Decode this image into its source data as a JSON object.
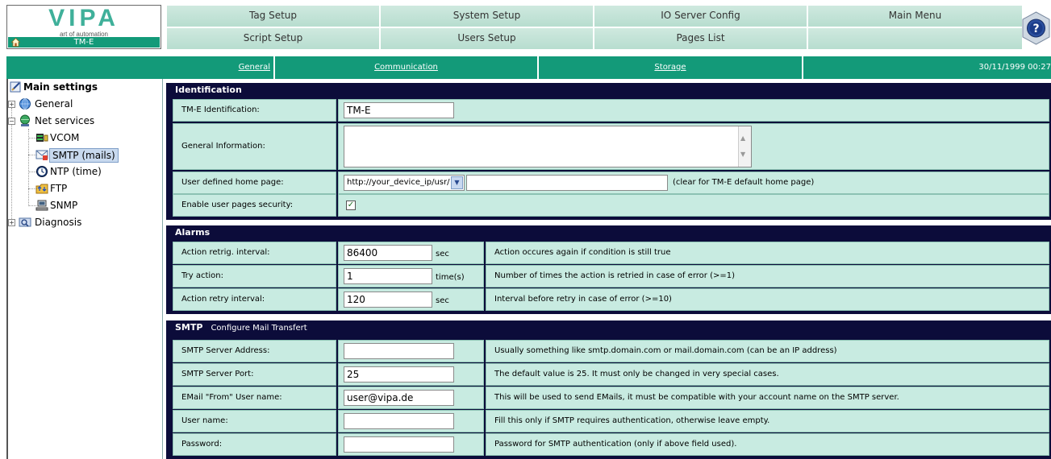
{
  "logo": {
    "name": "VIPA",
    "tagline": "art of automation",
    "device": "TM-E"
  },
  "menu": {
    "row1": [
      "Tag Setup",
      "System Setup",
      "IO Server Config",
      "Main Menu"
    ],
    "row2": [
      "Script Setup",
      "Users Setup",
      "Pages List",
      ""
    ]
  },
  "tabs": {
    "general": "General",
    "communication": "Communication",
    "storage": "Storage",
    "datetime": "30/11/1999 00:27"
  },
  "tree": {
    "root": "Main settings",
    "general": "General",
    "net_services": "Net services",
    "vcom": "VCOM",
    "smtp": "SMTP (mails)",
    "ntp": "NTP (time)",
    "ftp": "FTP",
    "snmp": "SNMP",
    "diagnosis": "Diagnosis"
  },
  "identification": {
    "title": "Identification",
    "tm_e_id_label": "TM-E Identification:",
    "tm_e_id_value": "TM-E",
    "general_info_label": "General Information:",
    "general_info_value": "",
    "home_page_label": "User defined home page:",
    "home_page_prefix": "http://your_device_ip/usr/",
    "home_page_value": "",
    "home_page_hint": "(clear for TM-E default home page)",
    "security_label": "Enable user pages security:",
    "security_checked": true
  },
  "alarms": {
    "title": "Alarms",
    "rows": [
      {
        "label": "Action retrig. interval:",
        "value": "86400",
        "unit": "sec",
        "desc": "Action occures again if condition is still true"
      },
      {
        "label": "Try action:",
        "value": "1",
        "unit": "time(s)",
        "desc": "Number of times the action is retried in case of error (>=1)"
      },
      {
        "label": "Action retry interval:",
        "value": "120",
        "unit": "sec",
        "desc": "Interval before retry in case of error (>=10)"
      }
    ]
  },
  "smtp": {
    "title": "SMTP",
    "subtitle": "Configure Mail Transfert",
    "rows": [
      {
        "label": "SMTP Server Address:",
        "value": "",
        "desc": "Usually something like smtp.domain.com or mail.domain.com (can be an IP address)"
      },
      {
        "label": "SMTP Server Port:",
        "value": "25",
        "desc": "The default value is 25. It must only be changed in very special cases."
      },
      {
        "label": "EMail \"From\" User name:",
        "value": "user@vipa.de",
        "desc": "This will be used to send EMails, it must be compatible with your account name on the SMTP server."
      },
      {
        "label": "User name:",
        "value": "",
        "desc": "Fill this only if SMTP requires authentication, otherwise leave empty."
      },
      {
        "label": "Password:",
        "value": "",
        "desc": "Password for SMTP authentication (only if above field used)."
      }
    ]
  },
  "colors": {
    "accent": "#139a79",
    "panel": "#0c0c3a",
    "cell": "#c8ebe1",
    "menu": "#cfe9df"
  }
}
